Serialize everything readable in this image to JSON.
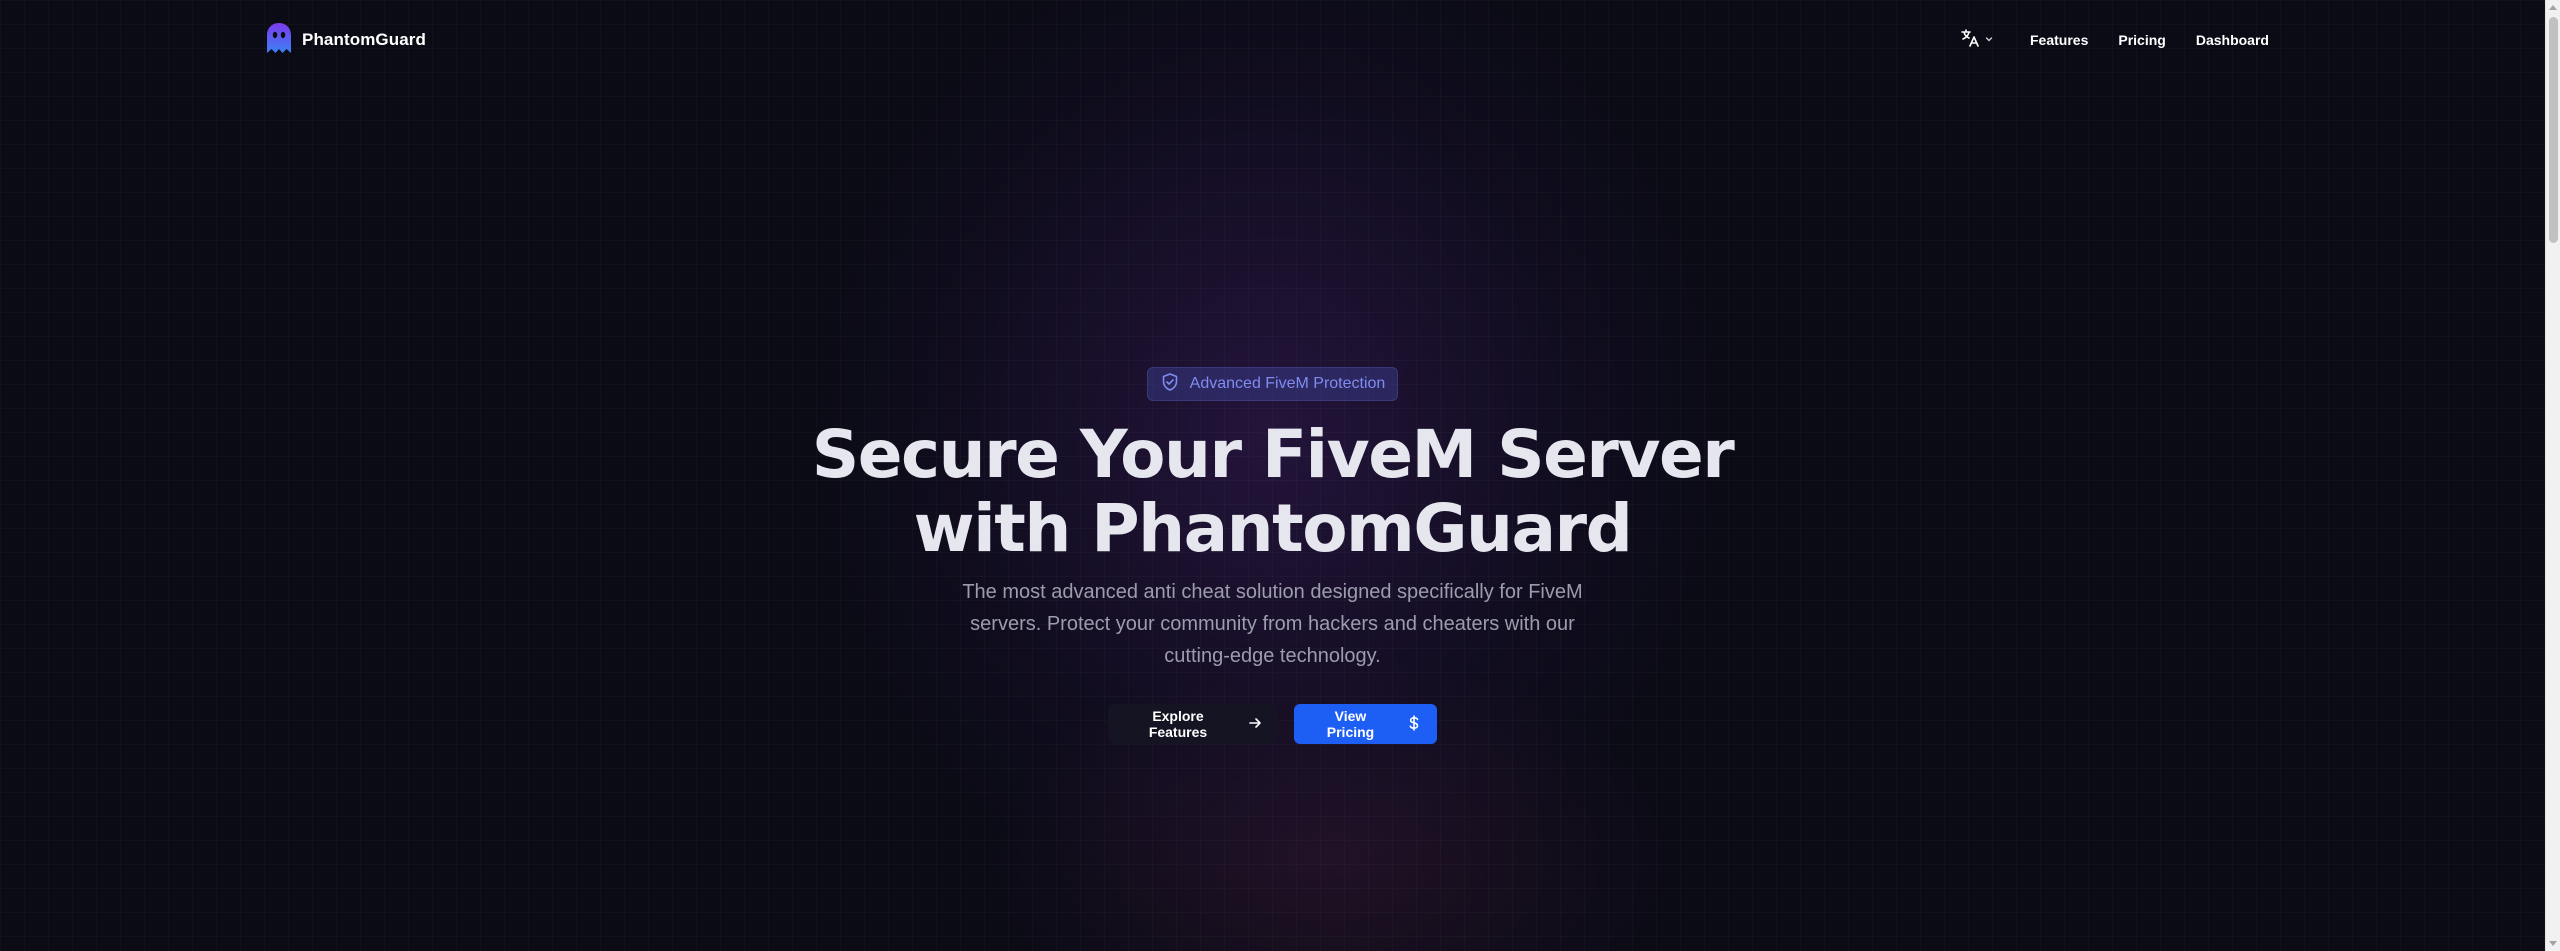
{
  "brand": {
    "name": "PhantomGuard",
    "icon": "ghost-icon",
    "colors": [
      "#7c3aed",
      "#3b82f6"
    ]
  },
  "nav": {
    "language_icon": "translate-icon",
    "language_chevron": "chevron-down-icon",
    "links": [
      {
        "label": "Features"
      },
      {
        "label": "Pricing"
      },
      {
        "label": "Dashboard"
      }
    ]
  },
  "hero": {
    "badge": {
      "icon": "shield-check-icon",
      "text": "Advanced FiveM Protection"
    },
    "title_line1": "Secure Your FiveM Server",
    "title_line2": "with PhantomGuard",
    "subtitle_line1": "The most advanced anti cheat solution designed specifically for FiveM",
    "subtitle_line2": "servers. Protect your community from hackers and cheaters with our",
    "subtitle_line3": "cutting-edge technology.",
    "cta_primary": {
      "label": "Explore Features",
      "icon": "arrow-right-icon"
    },
    "cta_secondary": {
      "label": "View Pricing",
      "icon": "dollar-icon"
    }
  },
  "theme": {
    "accent": "#1d5ef5",
    "badge_text": "#7f8cf0",
    "background": "#0b0b16"
  }
}
